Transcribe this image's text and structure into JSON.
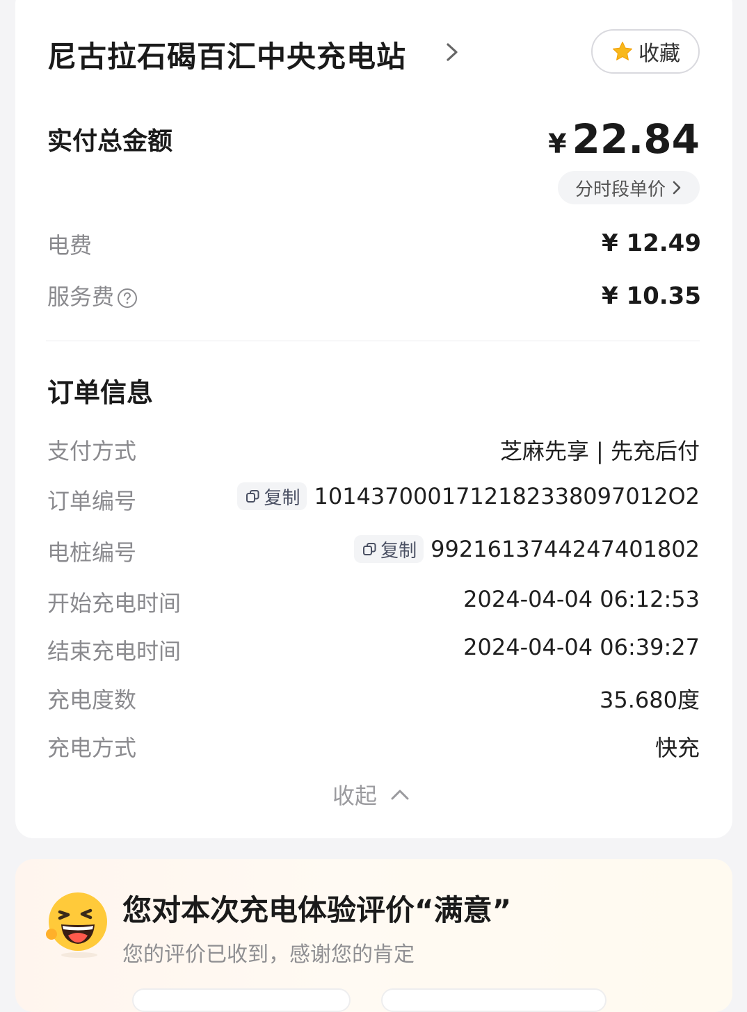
{
  "station": {
    "name": "尼古拉石碣百汇中央充电站"
  },
  "favorite": {
    "label": "收藏",
    "icon": "star-icon",
    "icon_color": "#f8b81c"
  },
  "payment": {
    "total_label": "实付总金额",
    "currency": "¥",
    "total_amount": "22.84",
    "time_of_use_label": "分时段单价",
    "fees": [
      {
        "label": "电费",
        "value": "¥ 12.49"
      },
      {
        "label": "服务费",
        "value": "¥ 10.35"
      }
    ]
  },
  "order_info": {
    "title": "订单信息",
    "copy_label": "复制",
    "rows": [
      {
        "label": "支付方式",
        "value": "芝麻先享 | 先充后付"
      },
      {
        "label": "订单编号",
        "value": "1014370001712182338097012О2"
      },
      {
        "label": "电桩编号",
        "value": "9921613744247401802"
      },
      {
        "label": "开始充电时间",
        "value": "2024-04-04 06:12:53"
      },
      {
        "label": "结束充电时间",
        "value": "2024-04-04 06:39:27"
      },
      {
        "label": "充电度数",
        "value": "35.680度"
      },
      {
        "label": "充电方式",
        "value": "快充"
      }
    ],
    "collapse_label": "收起"
  },
  "review": {
    "title": "您对本次充电体验评价“满意”",
    "subtitle": "您的评价已收到，感谢您的肯定",
    "icon": "smiley-emoji-icon"
  }
}
